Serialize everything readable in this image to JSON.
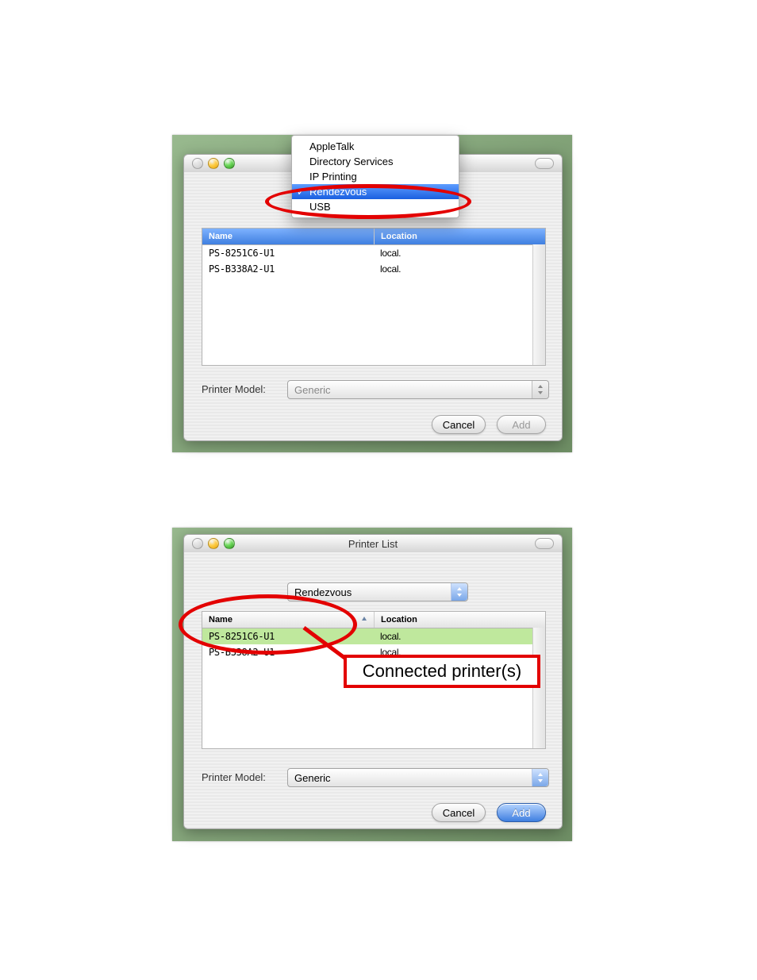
{
  "shot1": {
    "menu": {
      "items": [
        "AppleTalk",
        "Directory Services",
        "IP Printing",
        "Rendezvous",
        "USB"
      ],
      "selected_index": 3
    },
    "list": {
      "col_name": "Name",
      "col_location": "Location",
      "rows": [
        {
          "name": "PS-8251C6-U1",
          "location": "local."
        },
        {
          "name": "PS-B338A2-U1",
          "location": "local."
        }
      ]
    },
    "printer_model_label": "Printer Model:",
    "printer_model_value": "Generic",
    "cancel": "Cancel",
    "add": "Add"
  },
  "shot2": {
    "window_title": "Printer List",
    "connection_value": "Rendezvous",
    "list": {
      "col_name": "Name",
      "col_location": "Location",
      "rows": [
        {
          "name": "PS-8251C6-U1",
          "location": "local.",
          "selected": true
        },
        {
          "name": "PS-B338A2-U1",
          "location": "local.",
          "selected": false
        }
      ]
    },
    "printer_model_label": "Printer Model:",
    "printer_model_value": "Generic",
    "cancel": "Cancel",
    "add": "Add",
    "annotation": "Connected printer(s)"
  }
}
